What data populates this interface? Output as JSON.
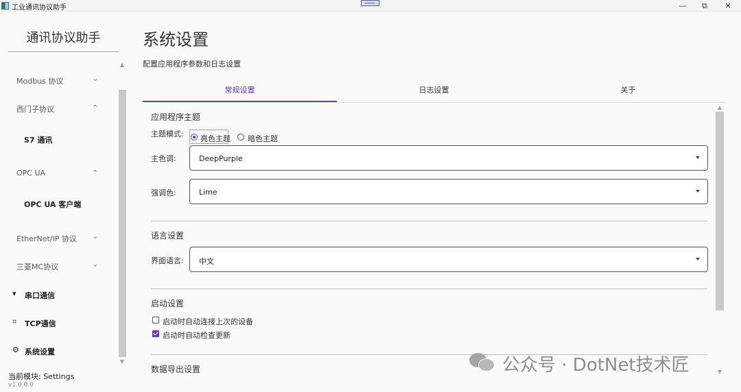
{
  "window": {
    "title": "工业通讯协议助手",
    "minimize_icon": "minimize-icon",
    "restore_icon": "restore-icon",
    "close_icon": "close-icon"
  },
  "sidebar": {
    "brand": "通讯协议助手",
    "items": [
      {
        "label": "Modbus 协议",
        "chevron": "chevron-down-icon"
      },
      {
        "label": "西门子协议",
        "chevron": "chevron-up-icon"
      },
      {
        "label": "S7 通讯"
      },
      {
        "label": "OPC UA",
        "chevron": "chevron-up-icon"
      },
      {
        "label": "OPC UA 客户端"
      },
      {
        "label": "EtherNet/IP 协议",
        "chevron": "chevron-down-icon"
      },
      {
        "label": "三菱MC协议",
        "chevron": "chevron-down-icon"
      },
      {
        "label": "串口通信",
        "icon": "serial-port-icon"
      },
      {
        "label": "TCP通信",
        "icon": "network-icon"
      },
      {
        "label": "系统设置",
        "icon": "gear-icon"
      }
    ],
    "status": "当前模块: Settings",
    "version": "v1.0.0.0"
  },
  "main": {
    "title": "系统设置",
    "subtitle": "配置应用程序参数和日志设置",
    "tabs": [
      {
        "label": "常规设置",
        "active": true
      },
      {
        "label": "日志设置",
        "active": false
      },
      {
        "label": "关于",
        "active": false
      }
    ],
    "theme_section": {
      "heading": "应用程序主题",
      "mode_label": "主题模式:",
      "mode_options": [
        {
          "label": "亮色主题",
          "selected": true
        },
        {
          "label": "暗色主题",
          "selected": false
        }
      ],
      "primary_label": "主色调:",
      "primary_value": "DeepPurple",
      "accent_label": "强调色:",
      "accent_value": "Lime"
    },
    "language_section": {
      "heading": "语言设置",
      "ui_language_label": "界面语言:",
      "ui_language_value": "中文"
    },
    "startup_section": {
      "heading": "启动设置",
      "options": [
        {
          "label": "启动时自动连接上次的设备",
          "checked": false
        },
        {
          "label": "启动时自动检查更新",
          "checked": true
        }
      ]
    },
    "export_section": {
      "heading": "数据导出设置"
    }
  },
  "watermark": {
    "text": "公众号 · DotNet技术匠",
    "icon": "wechat-icon"
  },
  "colors": {
    "accent": "#673ab7",
    "scrollbar": "#c9c9c9"
  }
}
